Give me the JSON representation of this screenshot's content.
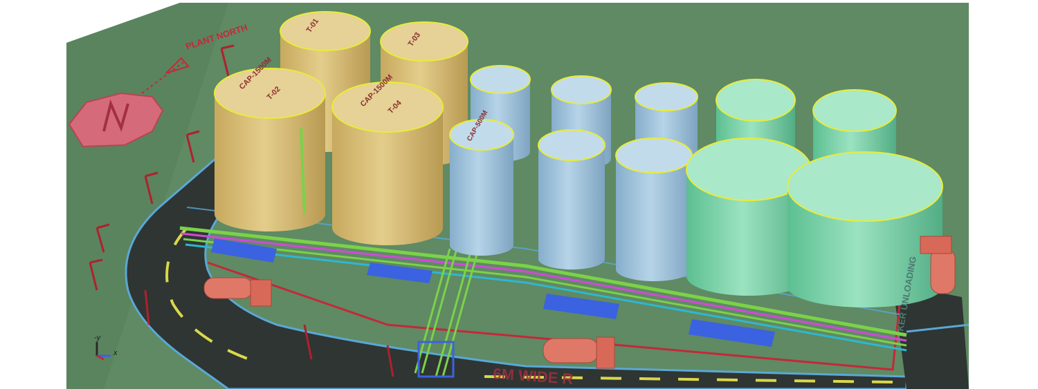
{
  "colors": {
    "ground": "#5f8a63",
    "ground_dark": "#4a7350",
    "road": "#2f3533",
    "road_edge": "#5aa8d8",
    "road_line": "#d9d84a",
    "bund": "#c4283a",
    "tank_yellow": "#d9c07a",
    "tank_blue": "#9fc3da",
    "tank_green": "#7fd0a8",
    "railing": "#e8ec3a",
    "pipe_green": "#7bd24a",
    "pipe_magenta": "#d04ad8",
    "pipe_blue": "#3b62e0",
    "truck": "#e07868",
    "annotation_red": "#c4283a"
  },
  "labels": {
    "plant_north": "PLANT NORTH",
    "road_text": "6M WIDE R",
    "unloading_text": "KER UNLOADING",
    "axis_y": "-y",
    "axis_x": "x",
    "tank_t01": "T-01",
    "tank_t02": "T-02",
    "tank_t03": "T-03",
    "tank_t04": "T-04",
    "tank_cap_yellow": "CAP-1500M",
    "tank_cap_blue": "CAP-500M"
  },
  "tanks": [
    {
      "id": "T-01",
      "group": "yellow"
    },
    {
      "id": "T-02",
      "group": "yellow"
    },
    {
      "id": "T-03",
      "group": "yellow"
    },
    {
      "id": "T-04",
      "group": "yellow"
    },
    {
      "id": "blue-1",
      "group": "blue"
    },
    {
      "id": "blue-2",
      "group": "blue"
    },
    {
      "id": "blue-3",
      "group": "blue"
    },
    {
      "id": "blue-4",
      "group": "blue"
    },
    {
      "id": "blue-5",
      "group": "blue"
    },
    {
      "id": "blue-6",
      "group": "blue"
    },
    {
      "id": "green-1",
      "group": "green"
    },
    {
      "id": "green-2",
      "group": "green"
    },
    {
      "id": "green-3",
      "group": "green"
    },
    {
      "id": "green-4",
      "group": "green"
    }
  ]
}
